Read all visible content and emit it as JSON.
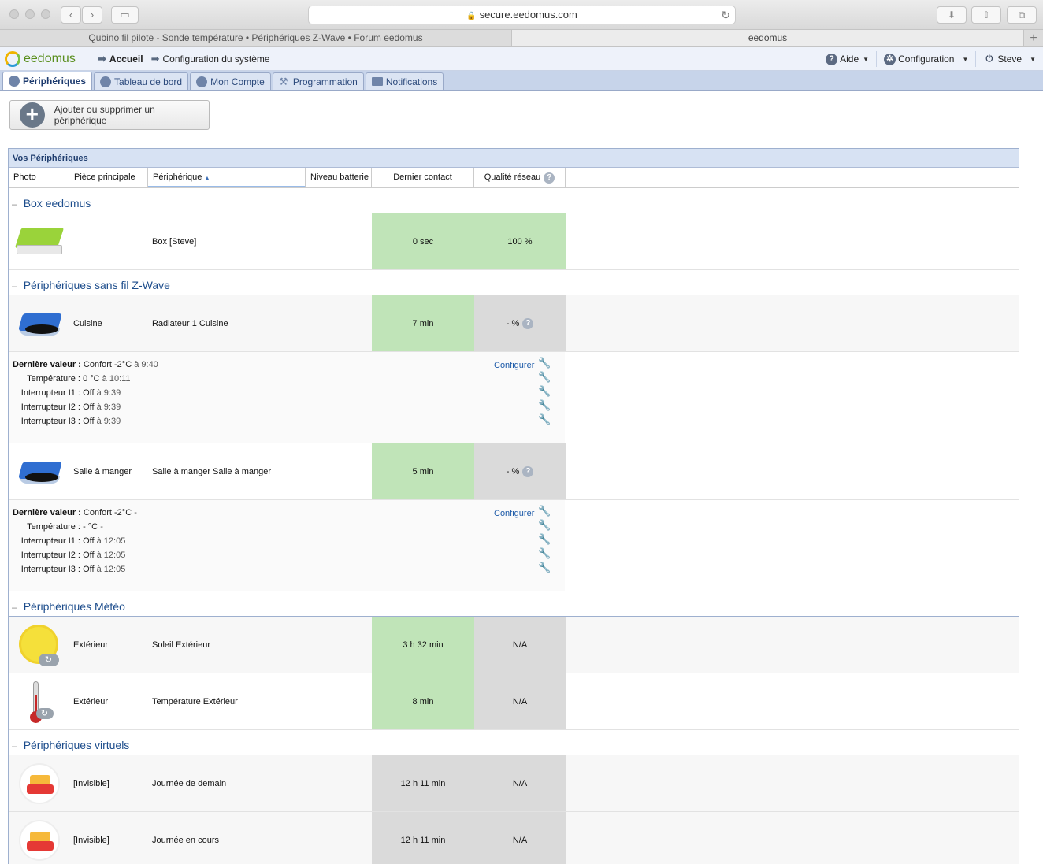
{
  "browser": {
    "url": "secure.eedomus.com",
    "tabs": [
      {
        "label": "Qubino fil pilote - Sonde température • Périphériques Z-Wave • Forum eedomus"
      },
      {
        "label": "eedomus"
      }
    ]
  },
  "app": {
    "logo_text": "eedomus",
    "breadcrumb": {
      "home": "Accueil",
      "config": "Configuration du système"
    },
    "header_right": {
      "help": "Aide",
      "configuration": "Configuration",
      "user": "Steve"
    },
    "tabs": [
      {
        "label": "Périphériques"
      },
      {
        "label": "Tableau de bord"
      },
      {
        "label": "Mon Compte"
      },
      {
        "label": "Programmation"
      },
      {
        "label": "Notifications"
      }
    ]
  },
  "add_button": "Ajouter ou supprimer un périphérique",
  "grid": {
    "title": "Vos Périphériques",
    "columns": {
      "photo": "Photo",
      "room": "Pièce principale",
      "device": "Périphérique",
      "battery": "Niveau batterie",
      "contact": "Dernier contact",
      "quality": "Qualité réseau"
    },
    "groups": {
      "box": "Box eedomus",
      "zwave": "Périphériques sans fil Z-Wave",
      "meteo": "Périphériques Météo",
      "virtual": "Périphériques virtuels"
    },
    "rows": {
      "box": {
        "room": "",
        "device": "Box [Steve]",
        "contact": "0 sec",
        "quality": "100 %"
      },
      "zw1": {
        "room": "Cuisine",
        "device": "Radiateur 1 Cuisine",
        "contact": "7 min",
        "quality": "- %"
      },
      "zw2": {
        "room": "Salle à manger",
        "device": "Salle à manger Salle à manger",
        "contact": "5 min",
        "quality": "- %"
      },
      "m1": {
        "room": "Extérieur",
        "device": "Soleil Extérieur",
        "contact": "3 h 32 min",
        "quality": "N/A"
      },
      "m2": {
        "room": "Extérieur",
        "device": "Température Extérieur",
        "contact": "8 min",
        "quality": "N/A"
      },
      "v1": {
        "room": "[Invisible]",
        "device": "Journée de demain",
        "contact": "12 h 11 min",
        "quality": "N/A"
      },
      "v2": {
        "room": "[Invisible]",
        "device": "Journée en cours",
        "contact": "12 h 11 min",
        "quality": "N/A"
      }
    },
    "details": {
      "configure": "Configurer",
      "zw1": [
        {
          "label": "Dernière valeur :",
          "value": "Confort -2°C",
          "time": "à 9:40"
        },
        {
          "label": "Température :",
          "value": "0 °C",
          "time": "à 10:11"
        },
        {
          "label": "Interrupteur I1 :",
          "value": "Off",
          "time": "à 9:39"
        },
        {
          "label": "Interrupteur I2 :",
          "value": "Off",
          "time": "à 9:39"
        },
        {
          "label": "Interrupteur I3 :",
          "value": "Off",
          "time": "à 9:39"
        }
      ],
      "zw2": [
        {
          "label": "Dernière valeur :",
          "value": "Confort -2°C",
          "time": "-"
        },
        {
          "label": "Température :",
          "value": "- °C",
          "time": "-"
        },
        {
          "label": "Interrupteur I1 :",
          "value": "Off",
          "time": "à 12:05"
        },
        {
          "label": "Interrupteur I2 :",
          "value": "Off",
          "time": "à 12:05"
        },
        {
          "label": "Interrupteur I3 :",
          "value": "Off",
          "time": "à 12:05"
        }
      ]
    }
  },
  "colors": {
    "green": "#c0e4b8",
    "grey": "#dadada",
    "accent": "#1d4d8c"
  }
}
